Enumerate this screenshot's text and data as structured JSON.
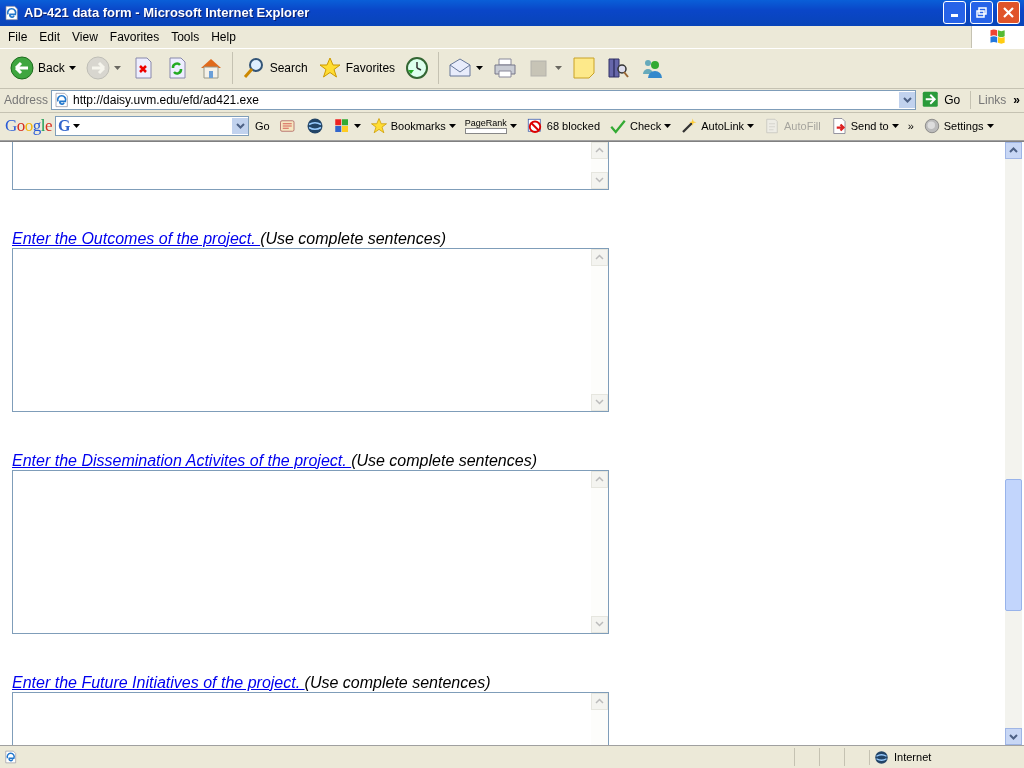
{
  "window": {
    "title": "AD-421 data form - Microsoft Internet Explorer"
  },
  "menu_bar": [
    "File",
    "Edit",
    "View",
    "Favorites",
    "Tools",
    "Help"
  ],
  "toolbar": [
    {
      "kind": "back",
      "label": "Back",
      "dropdown": true,
      "disabled": false
    },
    {
      "kind": "forward",
      "dropdown": true,
      "disabled": true
    },
    {
      "kind": "stop",
      "dropdown": false,
      "disabled": false
    },
    {
      "kind": "refresh",
      "dropdown": false,
      "disabled": false
    },
    {
      "kind": "home",
      "dropdown": false,
      "disabled": false
    },
    {
      "kind": "search",
      "label": "Search",
      "dropdown": false,
      "disabled": false
    },
    {
      "kind": "star",
      "label": "Favorites",
      "dropdown": false,
      "disabled": false
    },
    {
      "kind": "history",
      "dropdown": false,
      "disabled": false
    },
    {
      "kind": "mail",
      "dropdown": true,
      "disabled": false
    },
    {
      "kind": "print",
      "dropdown": false,
      "disabled": false
    },
    {
      "kind": "edit",
      "dropdown": true,
      "disabled": true
    },
    {
      "kind": "note",
      "dropdown": false,
      "disabled": false
    },
    {
      "kind": "research",
      "dropdown": false,
      "disabled": false
    },
    {
      "kind": "messenger",
      "dropdown": false,
      "disabled": false
    }
  ],
  "address_bar": {
    "label": "Address",
    "url": "http://daisy.uvm.edu/efd/ad421.exe",
    "go": "Go",
    "links": "Links",
    "more": "»"
  },
  "google_bar": {
    "logo": "Google",
    "search_logo": "G",
    "go": "Go",
    "items": [
      {
        "kind": "news",
        "dropdown": false,
        "disabled": false
      },
      {
        "kind": "globe",
        "dropdown": false,
        "disabled": false
      },
      {
        "kind": "puzzle",
        "dropdown": true,
        "disabled": false
      },
      {
        "kind": "star",
        "label": "Bookmarks",
        "dropdown": true,
        "disabled": false
      },
      {
        "kind": "pagerank",
        "label": "PageRank",
        "dropdown": true,
        "disabled": false
      },
      {
        "kind": "blocked",
        "label": "68 blocked",
        "dropdown": false,
        "disabled": false
      },
      {
        "kind": "check",
        "label": "Check",
        "dropdown": true,
        "disabled": false
      },
      {
        "kind": "wand",
        "label": "AutoLink",
        "dropdown": true,
        "disabled": false
      },
      {
        "kind": "autofill",
        "label": "AutoFill",
        "dropdown": false,
        "disabled": true
      },
      {
        "kind": "send",
        "label": "Send to",
        "dropdown": true,
        "disabled": false
      },
      {
        "kind": "chevrons",
        "label": "»",
        "dropdown": false,
        "disabled": false
      },
      {
        "kind": "settings",
        "label": "Settings",
        "dropdown": true,
        "disabled": false
      }
    ]
  },
  "form": {
    "sections": [
      {
        "link": "Enter the Outcomes of the project. ",
        "note": "(Use complete sentences)"
      },
      {
        "link": "Enter the Dissemination Activites of the project. ",
        "note": "(Use complete sentences)"
      },
      {
        "link": "Enter the Future Initiatives of the project. ",
        "note": "(Use complete sentences)"
      }
    ]
  },
  "status_bar": {
    "zone": "Internet"
  }
}
